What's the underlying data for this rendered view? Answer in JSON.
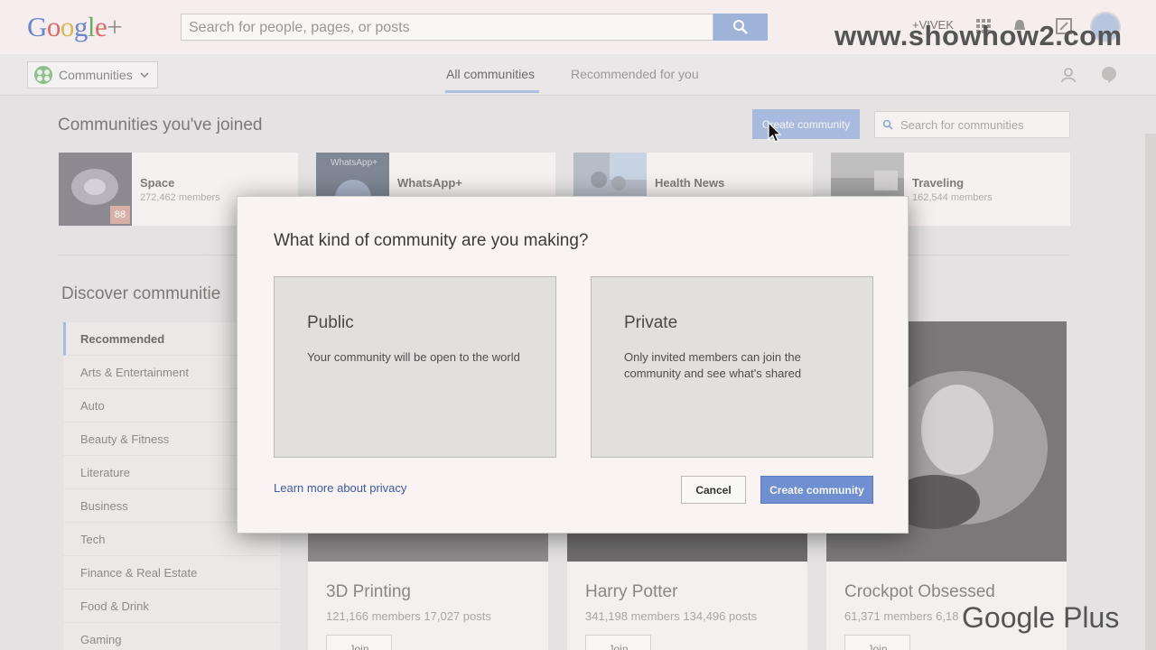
{
  "header": {
    "logo": {
      "p1": "G",
      "p2": "o",
      "p3": "o",
      "p4": "g",
      "p5": "l",
      "p6": "e",
      "p7": "+"
    },
    "search_placeholder": "Search for people, pages, or posts",
    "user_name": "+VIVEK",
    "watermark": "www.showhow2.com"
  },
  "subnav": {
    "dropdown_label": "Communities",
    "tabs": [
      {
        "label": "All communities",
        "active": true
      },
      {
        "label": "Recommended for you",
        "active": false
      }
    ]
  },
  "joined": {
    "title": "Communities you've joined",
    "create_label": "Create community",
    "search_placeholder": "Search for communities",
    "items": [
      {
        "name": "Space",
        "members": "272,462 members",
        "badge": "88"
      },
      {
        "name": "WhatsApp+",
        "members": "",
        "thumb_text": "WhatsApp+"
      },
      {
        "name": "Health News",
        "members": ""
      },
      {
        "name": "Traveling",
        "members": "162,544 members"
      }
    ]
  },
  "discover": {
    "title": "Discover communitie",
    "categories": [
      {
        "label": "Recommended",
        "active": true
      },
      {
        "label": "Arts & Entertainment",
        "active": false
      },
      {
        "label": "Auto",
        "active": false
      },
      {
        "label": "Beauty & Fitness",
        "active": false
      },
      {
        "label": "Literature",
        "active": false
      },
      {
        "label": "Business",
        "active": false
      },
      {
        "label": "Tech",
        "active": false
      },
      {
        "label": "Finance & Real Estate",
        "active": false
      },
      {
        "label": "Food & Drink",
        "active": false
      },
      {
        "label": "Gaming",
        "active": false
      }
    ],
    "cards": [
      {
        "title": "3D Printing",
        "meta": "121,166 members   17,027 posts",
        "join_label": "Join"
      },
      {
        "title": "Harry Potter",
        "meta": "341,198 members   134,496 posts",
        "join_label": "Join"
      },
      {
        "title": "Crockpot Obsessed",
        "meta": "61,371 members   6,18",
        "join_label": "Join"
      }
    ]
  },
  "modal": {
    "title": "What kind of community are you making?",
    "options": [
      {
        "title": "Public",
        "desc": "Your community will be open to the world"
      },
      {
        "title": "Private",
        "desc": "Only invited members can join the community and see what's shared"
      }
    ],
    "learn_link": "Learn more about privacy",
    "cancel_label": "Cancel",
    "create_label": "Create community"
  },
  "watermark_bottom": "Google Plus",
  "colors": {
    "accent": "#6f8fd0",
    "link": "#3d5a9e"
  }
}
